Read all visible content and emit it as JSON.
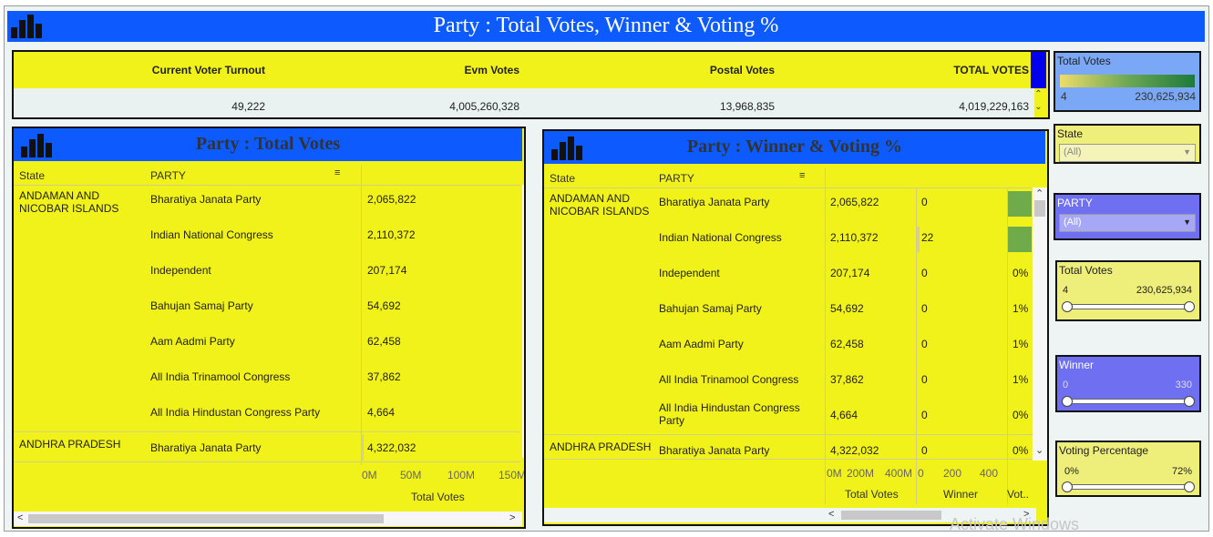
{
  "header": {
    "title": "Party : Total Votes, Winner & Voting %"
  },
  "kpi": {
    "headers": [
      "Current Voter Turnout",
      "Evm Votes",
      "Postal Votes",
      "TOTAL VOTES"
    ],
    "values": [
      "49,222",
      "4,005,260,328",
      "13,968,835",
      "4,019,229,163"
    ]
  },
  "legend_total_votes": {
    "label": "Total Votes",
    "min": "4",
    "max": "230,625,934"
  },
  "filter_state": {
    "label": "State",
    "value": "(All)"
  },
  "filter_party": {
    "label": "PARTY",
    "value": "(All)"
  },
  "slider_total_votes": {
    "label": "Total Votes",
    "min": "4",
    "max": "230,625,934"
  },
  "slider_winner": {
    "label": "Winner",
    "min": "0",
    "max": "330"
  },
  "slider_voting_pct": {
    "label": "Voting Percentage",
    "min": "0%",
    "max": "72%"
  },
  "left_table": {
    "title": "Party : Total Votes",
    "col_state": "State",
    "col_party": "PARTY",
    "axis_ticks": [
      "0M",
      "50M",
      "100M",
      "150M"
    ],
    "axis_label": "Total Votes",
    "rows": [
      {
        "state": "ANDAMAN AND NICOBAR ISLANDS",
        "party": "Bharatiya Janata Party",
        "votes": "2,065,822"
      },
      {
        "state": "",
        "party": "Indian National Congress",
        "votes": "2,110,372"
      },
      {
        "state": "",
        "party": "Independent",
        "votes": "207,174"
      },
      {
        "state": "",
        "party": "Bahujan Samaj Party",
        "votes": "54,692"
      },
      {
        "state": "",
        "party": "Aam Aadmi Party",
        "votes": "62,458"
      },
      {
        "state": "",
        "party": "All India Trinamool Congress",
        "votes": "37,862"
      },
      {
        "state": "",
        "party": "All India Hindustan Congress Party",
        "votes": "4,664"
      },
      {
        "state": "ANDHRA PRADESH",
        "party": "Bharatiya Janata Party",
        "votes": "4,322,032"
      }
    ]
  },
  "right_table": {
    "title": "Party : Winner & Voting %",
    "col_state": "State",
    "col_party": "PARTY",
    "axis_votes_ticks": [
      "0M",
      "200M",
      "400M"
    ],
    "axis_winner_ticks": [
      "0",
      "200",
      "400"
    ],
    "axis_labels": [
      "Total Votes",
      "Winner",
      "Vot.."
    ],
    "rows": [
      {
        "state": "ANDAMAN AND NICOBAR ISLANDS",
        "party": "Bharatiya Janata Party",
        "votes": "2,065,822",
        "winner": "0",
        "pct": ""
      },
      {
        "state": "",
        "party": "Indian National Congress",
        "votes": "2,110,372",
        "winner": "22",
        "pct": ""
      },
      {
        "state": "",
        "party": "Independent",
        "votes": "207,174",
        "winner": "0",
        "pct": "0%"
      },
      {
        "state": "",
        "party": "Bahujan Samaj Party",
        "votes": "54,692",
        "winner": "0",
        "pct": "1%"
      },
      {
        "state": "",
        "party": "Aam Aadmi Party",
        "votes": "62,458",
        "winner": "0",
        "pct": "1%"
      },
      {
        "state": "",
        "party": "All India Trinamool Congress",
        "votes": "37,862",
        "winner": "0",
        "pct": "1%"
      },
      {
        "state": "",
        "party": "All India Hindustan Congress Party",
        "votes": "4,664",
        "winner": "0",
        "pct": "0%"
      },
      {
        "state": "ANDHRA PRADESH",
        "party": "Bharatiya Janata Party",
        "votes": "4,322,032",
        "winner": "0",
        "pct": "0%"
      }
    ]
  },
  "watermark": "Activate Windows",
  "colors": {
    "title_blue": "#0d5bff",
    "panel_yellow": "#f2f21b",
    "filter_purple": "#6f6ff2",
    "legend_blue": "#7aa7f6"
  }
}
